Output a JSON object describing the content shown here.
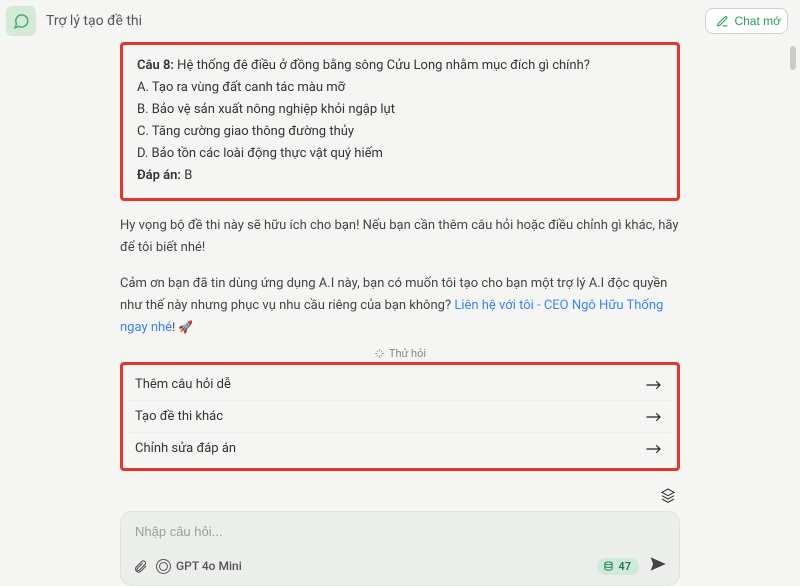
{
  "header": {
    "title": "Trợ lý tạo đề thi",
    "newChatLabel": "Chat mớ"
  },
  "question": {
    "label": "Câu 8:",
    "prompt": "Hệ thống đê điều ở đồng bằng sông Cửu Long nhằm mục đích gì chính?",
    "options": {
      "A": "Tạo ra vùng đất canh tác màu mỡ",
      "B": "Bảo vệ sản xuất nông nghiệp khỏi ngập lụt",
      "C": "Tăng cường giao thông đường thủy",
      "D": "Bảo tồn các loài động thực vật quý hiếm"
    },
    "answerLabel": "Đáp án:",
    "answer": "B"
  },
  "closing": "Hy vọng bộ đề thi này sẽ hữu ích cho bạn! Nếu bạn cần thêm câu hỏi hoặc điều chỉnh gì khác, hãy để tôi biết nhé!",
  "promo": {
    "text": "Cảm ơn bạn đã tin dùng ứng dụng A.I này, bạn có muốn tôi tạo cho bạn một trợ lý A.I độc quyền như thế này nhưng phục vụ nhu cầu riêng của bạn không? ",
    "linkText": "Liên hệ với tôi - CEO Ngô Hữu Thống ngay nhé",
    "tail": "! 🚀"
  },
  "tryit": "Thử hỏi",
  "suggestions": [
    "Thêm câu hỏi dễ",
    "Tạo đề thi khác",
    "Chỉnh sửa đáp án"
  ],
  "composer": {
    "placeholder": "Nhập câu hỏi...",
    "model": "GPT 4o Mini",
    "tokens": "47"
  }
}
